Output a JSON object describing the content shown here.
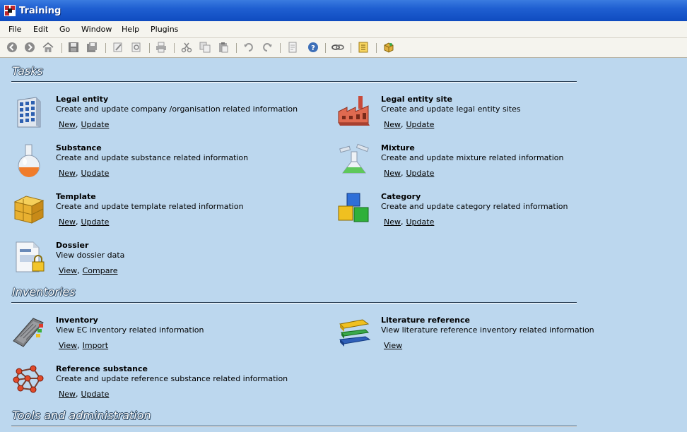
{
  "window": {
    "title": "Training"
  },
  "menu": [
    "File",
    "Edit",
    "Go",
    "Window",
    "Help",
    "Plugins"
  ],
  "toolbar_icons": [
    "back-icon",
    "forward-icon",
    "home-icon",
    "save-icon",
    "save-all-icon",
    "edit-icon",
    "preview-icon",
    "print-icon",
    "cut-icon",
    "copy-icon",
    "paste-icon",
    "undo-icon",
    "redo-icon",
    "document-icon",
    "help-icon",
    "link-icon",
    "notes-icon",
    "plugin-icon"
  ],
  "sections": {
    "tasks": "Tasks",
    "inventories": "Inventories",
    "tools": "Tools and administration"
  },
  "items": {
    "legal_entity": {
      "name": "Legal entity",
      "desc": "Create and update company /organisation related information",
      "l1": "New",
      "l2": "Update"
    },
    "legal_entity_site": {
      "name": "Legal entity site",
      "desc": "Create and update legal entity sites",
      "l1": "New",
      "l2": "Update"
    },
    "substance": {
      "name": "Substance",
      "desc": "Create and update substance related information",
      "l1": "New",
      "l2": "Update"
    },
    "mixture": {
      "name": "Mixture",
      "desc": "Create and update mixture related information",
      "l1": "New",
      "l2": "Update"
    },
    "template": {
      "name": "Template",
      "desc": "Create and update template related information",
      "l1": "New",
      "l2": "Update"
    },
    "category": {
      "name": "Category",
      "desc": "Create and update category related information",
      "l1": "New",
      "l2": "Update"
    },
    "dossier": {
      "name": "Dossier",
      "desc": "View dossier data",
      "l1": "View",
      "l2": "Compare"
    },
    "inventory": {
      "name": "Inventory",
      "desc": "View EC inventory related information",
      "l1": "View",
      "l2": "Import"
    },
    "literature": {
      "name": "Literature reference",
      "desc": "View literature reference inventory related information",
      "l1": "View"
    },
    "reference_substance": {
      "name": "Reference substance",
      "desc": "Create and update reference substance related information",
      "l1": "New",
      "l2": "Update"
    }
  }
}
